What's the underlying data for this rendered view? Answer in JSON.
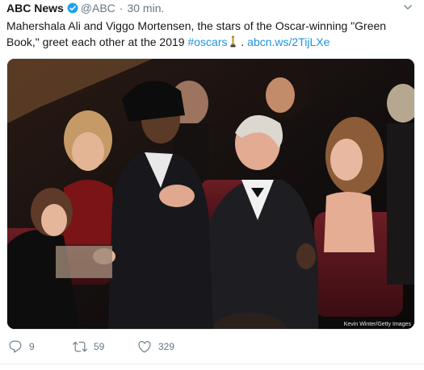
{
  "tweet": {
    "author_name": "ABC News",
    "handle": "@ABC",
    "separator": "·",
    "timestamp": "30 min.",
    "text_part1": "Mahershala Ali and Viggo Mortensen, the stars of the Oscar-winning \"Green Book,\" greet each other at the 2019 ",
    "hashtag": "#oscars",
    "text_part2": " . ",
    "link": "abcn.ws/2TijLXe",
    "photo_credit": "Kevin Winter/Getty Images",
    "verified_icon": "verified-badge-icon",
    "trophy_icon": "oscar-trophy-icon",
    "accent_color": "#1da1f2"
  },
  "actions": {
    "reply_count": "9",
    "retweet_count": "59",
    "like_count": "329"
  }
}
